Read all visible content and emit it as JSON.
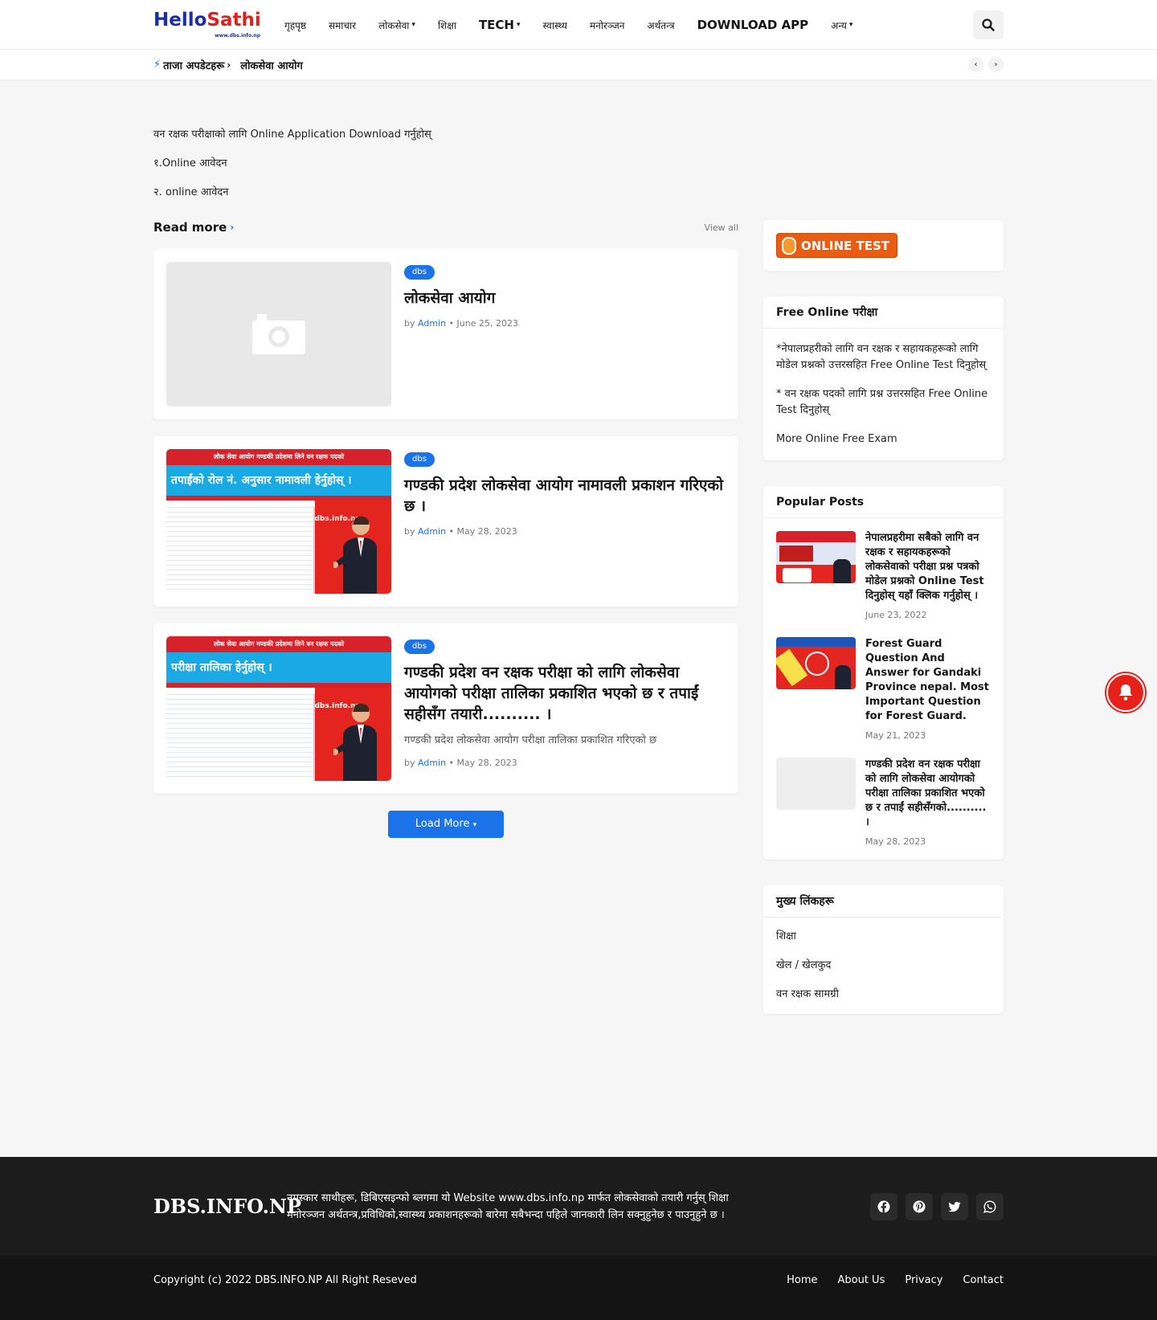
{
  "header": {
    "logo": {
      "part1": "Hello",
      "part2": "Sathi",
      "sub": "www.dbs.info.np"
    },
    "nav": [
      {
        "label": "गृहपृष्ठ",
        "has_chevron": false,
        "big": false
      },
      {
        "label": "समाचार",
        "has_chevron": false,
        "big": false
      },
      {
        "label": "लोकसेवा",
        "has_chevron": true,
        "big": false
      },
      {
        "label": "शिक्षा",
        "has_chevron": false,
        "big": false
      },
      {
        "label": "TECH",
        "has_chevron": true,
        "big": true
      },
      {
        "label": "स्वास्थ्य",
        "has_chevron": false,
        "big": false
      },
      {
        "label": "मनोरञ्जन",
        "has_chevron": false,
        "big": false
      },
      {
        "label": "अर्थतन्त्र",
        "has_chevron": false,
        "big": false
      },
      {
        "label": "DOWNLOAD APP",
        "has_chevron": false,
        "big": true
      },
      {
        "label": "अन्य",
        "has_chevron": true,
        "big": false
      }
    ]
  },
  "ticker": {
    "title": "ताजा अपडेटहरू",
    "item": "लोकसेवा आयोग"
  },
  "intro": [
    "वन रक्षक परीक्षाको लागि Online Application Download गर्नुहोस्",
    "१.Online आवेदन",
    "२. online आवेदन"
  ],
  "read_more": {
    "title": "Read more",
    "view_all": "View all"
  },
  "posts": [
    {
      "category": "dbs",
      "title": "लोकसेवा आयोग",
      "snippet": "",
      "by": "by",
      "author": "Admin",
      "date": "June 25, 2023",
      "thumb": "placeholder"
    },
    {
      "category": "dbs",
      "title": "गण्डकी प्रदेश लोकसेवा आयोग नामावली प्रकाशन गरिएको छ ।",
      "snippet": "",
      "by": "by",
      "author": "Admin",
      "date": "May 28, 2023",
      "thumb": "image",
      "banner_top": "लोक सेवा आयोग गण्डकी प्रदेशमा लिने वन रक्षक पदको",
      "banner_main": "तपाईंको रोल नं. अनुसार नामावली हेर्नुहोस् ।",
      "site": "dbs.info.np"
    },
    {
      "category": "dbs",
      "title": "गण्डकी प्रदेश वन रक्षक परीक्षा को लागि लोकसेवा आयोगको परीक्षा तालिका प्रकाशित भएको छ र तपाईं सहीसँग तयारी.......... ।",
      "snippet": "गण्डकी प्रदेश लोकसेवा आयोग परीक्षा तालिका प्रकाशित गरिएको छ",
      "by": "by",
      "author": "Admin",
      "date": "May 28, 2023",
      "thumb": "image",
      "banner_top": "लोक सेवा आयोग गण्डकी प्रदेशमा लिने वन रक्षक पदको",
      "banner_main": "परीक्षा तालिका हेर्नुहोस् ।",
      "site": "dbs.info.np"
    }
  ],
  "load_more": "Load More",
  "sidebar": {
    "online_test": "ONLINE TEST",
    "free_widget": {
      "title": "Free Online परीक्षा",
      "links": [
        "*नेपालप्रहरीको लागि वन रक्षक र सहायकहरूको लागि मोडेल प्रश्नको उत्तरसहित Free Online Test दिनुहोस्",
        "* वन रक्षक पदको लागि प्रश्न उत्तरसहित Free Online Test दिनुहोस्",
        "More Online Free Exam"
      ]
    },
    "popular": {
      "title": "Popular Posts",
      "items": [
        {
          "title": "नेपालप्रहरीमा सबैको लागि वन रक्षक र सहायकहरूको लोकसेवाको परीक्षा प्रश्न पत्रको मोडेल प्रश्नको Online Test दिनुहोस् यहाँ क्लिक गर्नुहोस् ।",
          "date": "June 23, 2022",
          "thumb": "image1"
        },
        {
          "title": "Forest Guard Question And Answer for Gandaki Province nepal. Most Important Question for Forest Guard.",
          "date": "May 21, 2023",
          "thumb": "image2"
        },
        {
          "title": "गण्डकी प्रदेश वन रक्षक परीक्षा को लागि लोकसेवा आयोगको परीक्षा तालिका प्रकाशित भएको छ र तपाईं सहीसँगको.......... ।",
          "date": "May 28, 2023",
          "thumb": "placeholder"
        }
      ]
    },
    "categories": {
      "title": "मुख्य लिंकहरू",
      "links": [
        "शिक्षा",
        "खेल / खेलकुद",
        "वन रक्षक सामग्री"
      ]
    }
  },
  "footer": {
    "logo": "DBS.INFO.NP",
    "about": "नमस्कार साथीहरू, डिबिएसइन्फो ब्लगमा यो Website www.dbs.info.np मार्फत लोकसेवाको तयारी गर्नुस् शिक्षा मनोरञ्जन अर्थतन्त्र,प्रविधिको,स्वास्थ्य प्रकाशनहरूको बारेमा सबैभन्दा पहिले जानकारी लिन सक्नुहुनेछ र पाउनुहुने छ ।",
    "socials": [
      "facebook-icon",
      "pinterest-icon",
      "twitter-icon",
      "whatsapp-icon"
    ],
    "copyright": "Copyright (c) 2022 DBS.INFO.NP All Right Reseved",
    "links": [
      "Home",
      "About Us",
      "Privacy",
      "Contact"
    ]
  },
  "colors": {
    "accent": "#1a73e8",
    "footer_bg": "#1c1c1c",
    "bell": "#e8201a"
  }
}
